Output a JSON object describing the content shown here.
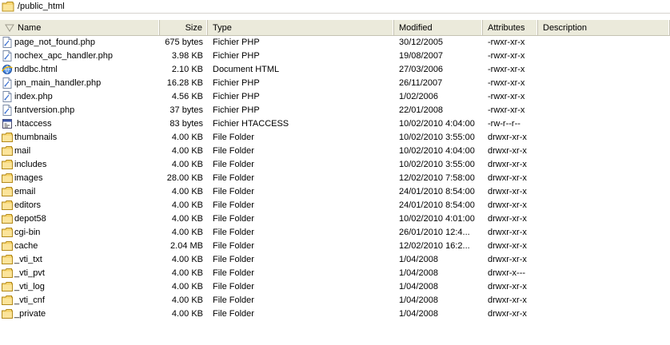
{
  "path": "/public_html",
  "columns": {
    "name": "Name",
    "size": "Size",
    "type": "Type",
    "modified": "Modified",
    "attributes": "Attributes",
    "description": "Description"
  },
  "files": [
    {
      "name": "page_not_found.php",
      "size": "675 bytes",
      "type": "Fichier PHP",
      "modified": "30/12/2005",
      "attributes": "-rwxr-xr-x",
      "icon": "php-file-icon"
    },
    {
      "name": "nochex_apc_handler.php",
      "size": "3.98 KB",
      "type": "Fichier PHP",
      "modified": "19/08/2007",
      "attributes": "-rwxr-xr-x",
      "icon": "php-file-icon"
    },
    {
      "name": "nddbc.html",
      "size": "2.10 KB",
      "type": "Document HTML",
      "modified": "27/03/2006",
      "attributes": "-rwxr-xr-x",
      "icon": "html-file-icon"
    },
    {
      "name": "ipn_main_handler.php",
      "size": "16.28 KB",
      "type": "Fichier PHP",
      "modified": "26/11/2007",
      "attributes": "-rwxr-xr-x",
      "icon": "php-file-icon"
    },
    {
      "name": "index.php",
      "size": "4.56 KB",
      "type": "Fichier PHP",
      "modified": "1/02/2006",
      "attributes": "-rwxr-xr-x",
      "icon": "php-file-icon"
    },
    {
      "name": "fantversion.php",
      "size": "37 bytes",
      "type": "Fichier PHP",
      "modified": "22/01/2008",
      "attributes": "-rwxr-xr-x",
      "icon": "php-file-icon"
    },
    {
      "name": ".htaccess",
      "size": "83 bytes",
      "type": "Fichier HTACCESS",
      "modified": "10/02/2010 4:04:00",
      "attributes": "-rw-r--r--",
      "icon": "htaccess-file-icon"
    },
    {
      "name": "thumbnails",
      "size": "4.00 KB",
      "type": "File Folder",
      "modified": "10/02/2010 3:55:00",
      "attributes": "drwxr-xr-x",
      "icon": "folder-icon"
    },
    {
      "name": "mail",
      "size": "4.00 KB",
      "type": "File Folder",
      "modified": "10/02/2010 4:04:00",
      "attributes": "drwxr-xr-x",
      "icon": "folder-icon"
    },
    {
      "name": "includes",
      "size": "4.00 KB",
      "type": "File Folder",
      "modified": "10/02/2010 3:55:00",
      "attributes": "drwxr-xr-x",
      "icon": "folder-icon"
    },
    {
      "name": "images",
      "size": "28.00 KB",
      "type": "File Folder",
      "modified": "12/02/2010 7:58:00",
      "attributes": "drwxr-xr-x",
      "icon": "folder-icon"
    },
    {
      "name": "email",
      "size": "4.00 KB",
      "type": "File Folder",
      "modified": "24/01/2010 8:54:00",
      "attributes": "drwxr-xr-x",
      "icon": "folder-icon"
    },
    {
      "name": "editors",
      "size": "4.00 KB",
      "type": "File Folder",
      "modified": "24/01/2010 8:54:00",
      "attributes": "drwxr-xr-x",
      "icon": "folder-icon"
    },
    {
      "name": "depot58",
      "size": "4.00 KB",
      "type": "File Folder",
      "modified": "10/02/2010 4:01:00",
      "attributes": "drwxr-xr-x",
      "icon": "folder-icon"
    },
    {
      "name": "cgi-bin",
      "size": "4.00 KB",
      "type": "File Folder",
      "modified": "26/01/2010 12:4...",
      "attributes": "drwxr-xr-x",
      "icon": "folder-icon"
    },
    {
      "name": "cache",
      "size": "2.04 MB",
      "type": "File Folder",
      "modified": "12/02/2010 16:2...",
      "attributes": "drwxr-xr-x",
      "icon": "folder-icon"
    },
    {
      "name": "_vti_txt",
      "size": "4.00 KB",
      "type": "File Folder",
      "modified": "1/04/2008",
      "attributes": "drwxr-xr-x",
      "icon": "folder-icon"
    },
    {
      "name": "_vti_pvt",
      "size": "4.00 KB",
      "type": "File Folder",
      "modified": "1/04/2008",
      "attributes": "drwxr-x---",
      "icon": "folder-icon"
    },
    {
      "name": "_vti_log",
      "size": "4.00 KB",
      "type": "File Folder",
      "modified": "1/04/2008",
      "attributes": "drwxr-xr-x",
      "icon": "folder-icon"
    },
    {
      "name": "_vti_cnf",
      "size": "4.00 KB",
      "type": "File Folder",
      "modified": "1/04/2008",
      "attributes": "drwxr-xr-x",
      "icon": "folder-icon"
    },
    {
      "name": "_private",
      "size": "4.00 KB",
      "type": "File Folder",
      "modified": "1/04/2008",
      "attributes": "drwxr-xr-x",
      "icon": "folder-icon"
    }
  ]
}
